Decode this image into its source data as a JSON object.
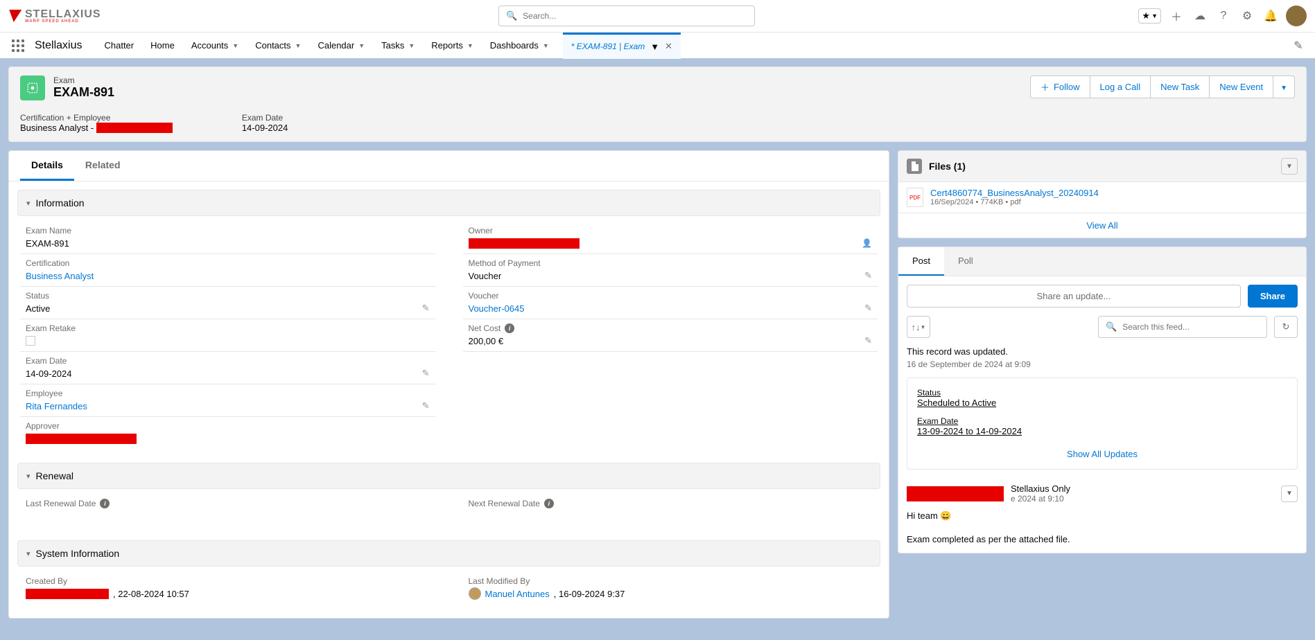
{
  "logo": {
    "name": "STELLAXIUS",
    "tagline": "WARP SPEED AHEAD"
  },
  "search": {
    "placeholder": "Search..."
  },
  "app_name": "Stellaxius",
  "nav_items": [
    "Chatter",
    "Home",
    "Accounts",
    "Contacts",
    "Calendar",
    "Tasks",
    "Reports",
    "Dashboards"
  ],
  "open_tab": "* EXAM-891 | Exam",
  "record": {
    "object": "Exam",
    "title": "EXAM-891",
    "actions": {
      "follow": "Follow",
      "log_call": "Log a Call",
      "new_task": "New Task",
      "new_event": "New Event"
    }
  },
  "highlights": {
    "cert_label": "Certification + Employee",
    "cert_value": "Business Analyst - ",
    "date_label": "Exam Date",
    "date_value": "14-09-2024"
  },
  "tabs": {
    "details": "Details",
    "related": "Related"
  },
  "sections": {
    "info": "Information",
    "renewal": "Renewal",
    "sysinfo": "System Information"
  },
  "fields": {
    "exam_name": {
      "label": "Exam Name",
      "value": "EXAM-891"
    },
    "certification": {
      "label": "Certification",
      "value": "Business Analyst"
    },
    "status": {
      "label": "Status",
      "value": "Active"
    },
    "retake": {
      "label": "Exam Retake"
    },
    "exam_date": {
      "label": "Exam Date",
      "value": "14-09-2024"
    },
    "employee": {
      "label": "Employee",
      "value": "Rita Fernandes"
    },
    "approver": {
      "label": "Approver"
    },
    "owner": {
      "label": "Owner"
    },
    "payment": {
      "label": "Method of Payment",
      "value": "Voucher"
    },
    "voucher": {
      "label": "Voucher",
      "value": "Voucher-0645"
    },
    "netcost": {
      "label": "Net Cost",
      "value": "200,00 €"
    },
    "last_renewal": {
      "label": "Last Renewal Date"
    },
    "next_renewal": {
      "label": "Next Renewal Date"
    },
    "created_by": {
      "label": "Created By",
      "date": ", 22-08-2024 10:57"
    },
    "modified_by": {
      "label": "Last Modified By",
      "name": "Manuel Antunes",
      "date": ", 16-09-2024 9:37"
    }
  },
  "files_card": {
    "title": "Files (1)",
    "file_name": "Cert4860774_BusinessAnalyst_20240914",
    "file_meta": "16/Sep/2024 • 774KB • pdf",
    "view_all": "View All"
  },
  "feed": {
    "tabs": {
      "post": "Post",
      "poll": "Poll"
    },
    "compose_placeholder": "Share an update...",
    "share_btn": "Share",
    "search_placeholder": "Search this feed...",
    "update_summary": "This record was updated.",
    "update_time": "16 de September de 2024 at 9:09",
    "change_status_label": "Status",
    "change_status_val": "Scheduled to Active",
    "change_date_label": "Exam Date",
    "change_date_val": "13-09-2024 to 14-09-2024",
    "show_all": "Show All Updates",
    "post": {
      "visibility": " Stellaxius Only",
      "time": "e 2024 at 9:10",
      "line1": "Hi team 😀",
      "line2": "Exam completed as per the attached file."
    }
  }
}
